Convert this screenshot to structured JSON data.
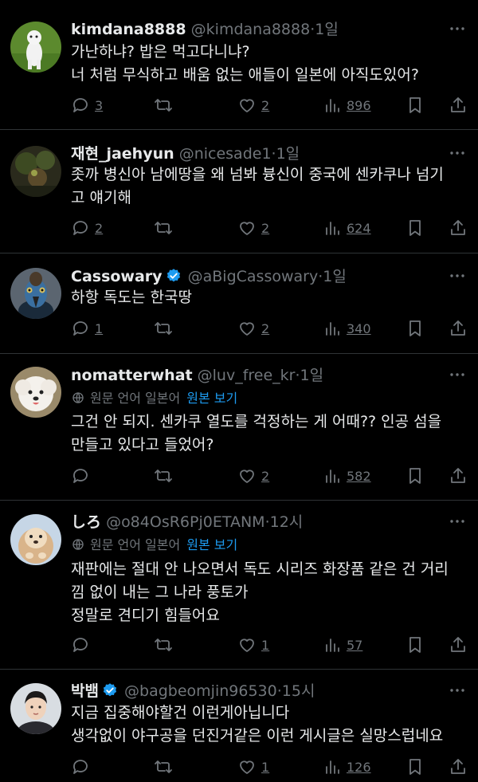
{
  "tweets": [
    {
      "name": "kimdana8888",
      "handle": "@kimdana8888",
      "time": "1일",
      "verified": false,
      "translated": false,
      "text": "가난하냐? 밥은 먹고다니냐?\n너 처럼 무식하고 배움 없는 애들이 일본에 아직도있어?",
      "replies": "3",
      "retweets": "",
      "likes": "2",
      "views": "896",
      "avatar_icon": "white-dog-on-grass-avatar"
    },
    {
      "name": "재현_jaehyun",
      "handle": "@nicesade1",
      "time": "1일",
      "verified": false,
      "translated": false,
      "text": "좃까 병신아 남에땅을 왜 넘봐 븅신이 중국에 센카쿠나 넘기\n고 얘기해",
      "replies": "2",
      "retweets": "",
      "likes": "2",
      "views": "624",
      "avatar_icon": "dark-forest-avatar"
    },
    {
      "name": "Cassowary",
      "handle": "@aBigCassowary",
      "time": "1일",
      "verified": true,
      "translated": false,
      "text": "하항 독도는 한국땅",
      "replies": "1",
      "retweets": "",
      "likes": "2",
      "views": "340",
      "avatar_icon": "cassowary-bird-avatar"
    },
    {
      "name": "nomatterwhat",
      "handle": "@luv_free_kr",
      "time": "1일",
      "verified": false,
      "translated": true,
      "text": "그건 안 되지. 센카쿠 열도를 걱정하는 게 어때?? 인공 섬을\n만들고 있다고 들었어?",
      "replies": "",
      "retweets": "",
      "likes": "2",
      "views": "582",
      "avatar_icon": "white-puppy-avatar"
    },
    {
      "name": "しろ",
      "handle": "@o84OsR6Pj0ETANM",
      "time": "12시",
      "verified": false,
      "translated": true,
      "text": "재판에는 절대 안 나오면서 독도 시리즈 화장품 같은 건 거리\n낌 없이 내는 그 나라 풍토가\n정말로 견디기 힘들어요",
      "replies": "",
      "retweets": "",
      "likes": "1",
      "views": "57",
      "avatar_icon": "fluffy-puppy-avatar"
    },
    {
      "name": "박뱀",
      "handle": "@bagbeomjin96530",
      "time": "15시",
      "verified": true,
      "translated": false,
      "text": "지금 집중해야할건 이런게아닙니다\n생각없이 야구공을 던진거같은 이런 게시글은 실망스럽네요",
      "replies": "",
      "retweets": "",
      "likes": "1",
      "views": "126",
      "avatar_icon": "young-man-portrait-avatar"
    }
  ],
  "translation": {
    "notice": "원문 언어 일본어",
    "show_original": "원본 보기"
  },
  "separator": "·",
  "colors": {
    "background": "#000000",
    "text": "#e7e9ea",
    "secondary": "#71767b",
    "link": "#1d9bf0",
    "divider": "#2f3336"
  }
}
